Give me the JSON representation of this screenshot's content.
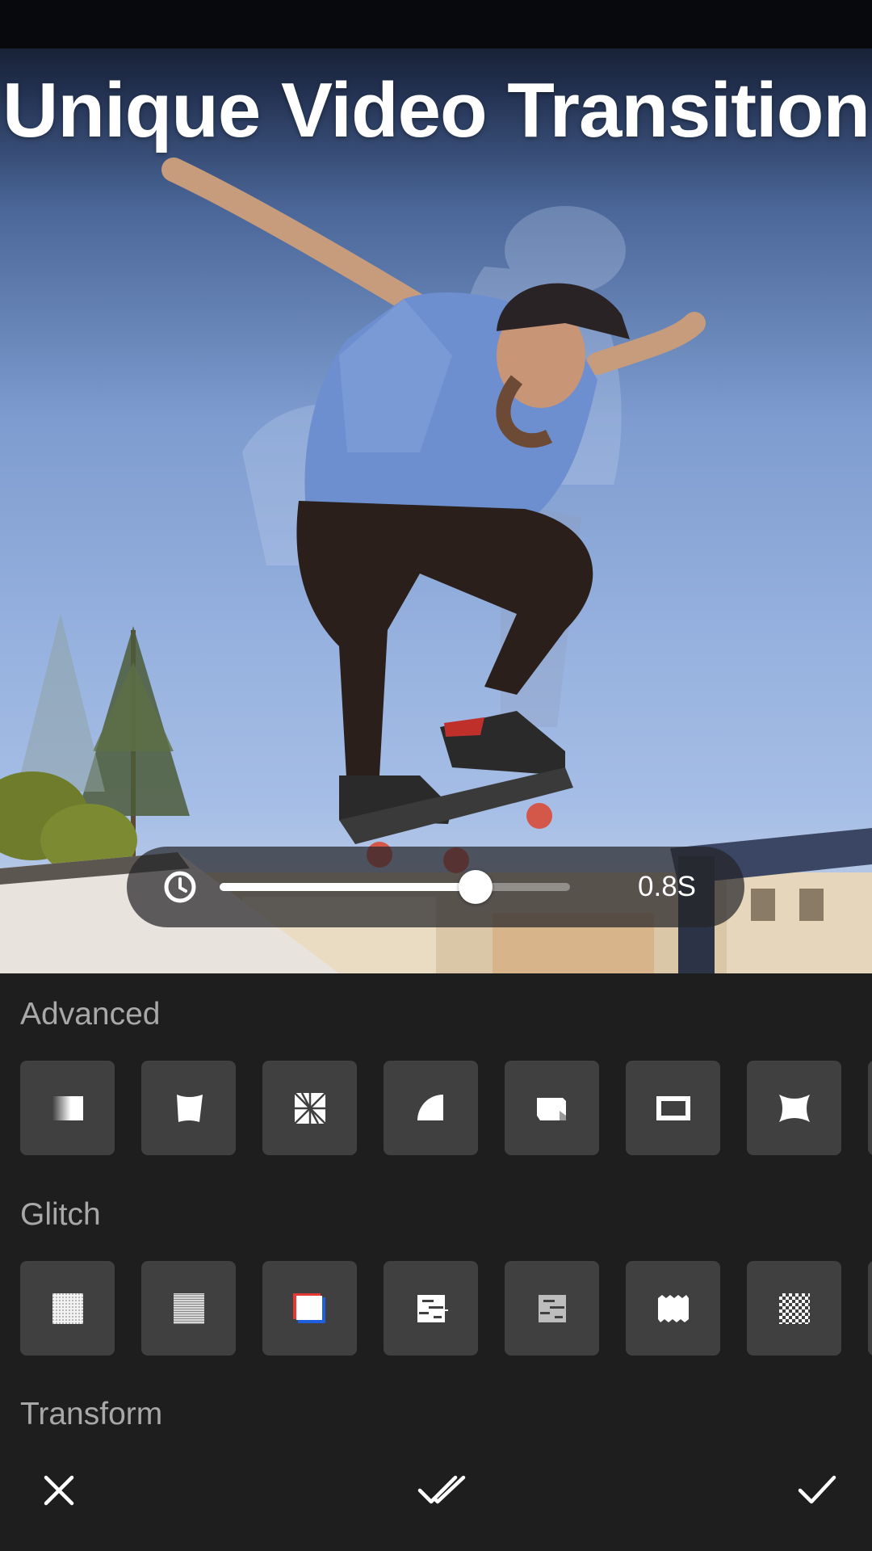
{
  "headline": "Unique Video Transition",
  "duration": {
    "icon": "clock-icon",
    "value_label": "0.8S",
    "progress": 0.73
  },
  "sections": [
    {
      "title": "Advanced",
      "tiles": [
        {
          "icon": "fade-square-icon"
        },
        {
          "icon": "warp-square-icon"
        },
        {
          "icon": "radial-burst-icon"
        },
        {
          "icon": "quarter-circle-icon"
        },
        {
          "icon": "page-curl-icon"
        },
        {
          "icon": "frame-icon"
        },
        {
          "icon": "pinch-square-icon"
        }
      ]
    },
    {
      "title": "Glitch",
      "tiles": [
        {
          "icon": "noise-icon"
        },
        {
          "icon": "static-lines-icon"
        },
        {
          "icon": "rgb-split-icon"
        },
        {
          "icon": "glitch-bars-icon"
        },
        {
          "icon": "glitch-bars-dim-icon"
        },
        {
          "icon": "torn-edge-icon"
        },
        {
          "icon": "checkerboard-icon"
        }
      ]
    },
    {
      "title": "Transform",
      "tiles": []
    }
  ],
  "bottom_bar": {
    "cancel_icon": "close-icon",
    "apply_all_icon": "double-check-icon",
    "confirm_icon": "check-icon"
  },
  "colors": {
    "panel_bg": "#1e1e1e",
    "tile_bg": "#404040",
    "section_title": "#a8a8a8",
    "accent_red": "#e53935",
    "accent_blue": "#1e5fe0"
  }
}
